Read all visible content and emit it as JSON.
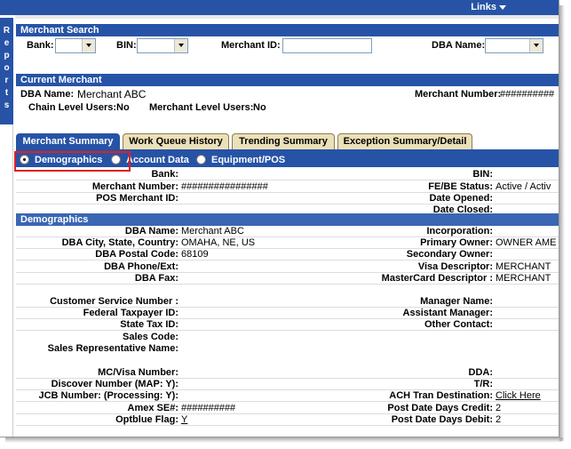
{
  "header": {
    "links_label": "Links"
  },
  "reports_tab": {
    "letters": [
      "R",
      "e",
      "p",
      "o",
      "r",
      "t",
      "s"
    ]
  },
  "merchant_search": {
    "title": "Merchant Search",
    "bank_label": "Bank:",
    "bin_label": "BIN:",
    "merchant_id_label": "Merchant ID:",
    "dba_name_label": "DBA Name:"
  },
  "current_merchant": {
    "title": "Current Merchant",
    "dba_name_label": "DBA Name:",
    "dba_name_value": "Merchant ABC",
    "merchant_number_label": "Merchant Number:",
    "merchant_number_value": "##########",
    "chain_users_label": "Chain Level Users:",
    "chain_users_value": "No",
    "merchant_users_label": "Merchant Level Users:",
    "merchant_users_value": "No"
  },
  "tabs": [
    {
      "label": "Merchant Summary"
    },
    {
      "label": "Work Queue History"
    },
    {
      "label": "Trending Summary"
    },
    {
      "label": "Exception Summary/Detail"
    }
  ],
  "radios": [
    {
      "label": "Demographics"
    },
    {
      "label": "Account Data"
    },
    {
      "label": "Equipment/POS"
    }
  ],
  "summary": {
    "bank_label": "Bank:",
    "bin_label": "BIN:",
    "merchant_number_label": "Merchant Number:",
    "merchant_number_value": "################",
    "febe_label": "FE/BE Status:",
    "febe_value": "Active / Activ",
    "pos_label": "POS Merchant ID:",
    "date_opened_label": "Date Opened:",
    "date_closed_label": "Date Closed:"
  },
  "demographics": {
    "title": "Demographics",
    "left": [
      {
        "label": "DBA Name:",
        "value": "Merchant ABC"
      },
      {
        "label": "DBA City, State, Country:",
        "value": "OMAHA, NE, US"
      },
      {
        "label": "DBA Postal Code:",
        "value": "68109"
      },
      {
        "label": "DBA Phone/Ext:",
        "value": ""
      },
      {
        "label": "DBA Fax:",
        "value": ""
      }
    ],
    "right": [
      {
        "label": "Incorporation:",
        "value": ""
      },
      {
        "label": "Primary Owner:",
        "value": "OWNER AME"
      },
      {
        "label": "Secondary Owner:",
        "value": ""
      },
      {
        "label": "Visa Descriptor:",
        "value": "MERCHANT"
      },
      {
        "label": "MasterCard Descriptor :",
        "value": "MERCHANT"
      }
    ],
    "left2": [
      {
        "label": "Customer Service Number :",
        "value": ""
      },
      {
        "label": "Federal Taxpayer ID:",
        "value": ""
      },
      {
        "label": "State Tax ID:",
        "value": ""
      },
      {
        "label": "Sales Code:",
        "value": ""
      },
      {
        "label": "Sales Representative Name:",
        "value": ""
      }
    ],
    "right2": [
      {
        "label": "Manager Name:",
        "value": ""
      },
      {
        "label": "Assistant Manager:",
        "value": ""
      },
      {
        "label": "Other Contact:",
        "value": ""
      }
    ],
    "left3": [
      {
        "label": "MC/Visa Number:",
        "value": ""
      },
      {
        "label": "Discover Number (MAP: Y):",
        "value": ""
      },
      {
        "label": "JCB Number: (Processing: Y):",
        "value": ""
      },
      {
        "label": "Amex SE#:",
        "value": "##########"
      },
      {
        "label": "Optblue Flag:",
        "value": "Y"
      }
    ],
    "right3": [
      {
        "label": "DDA:",
        "value": ""
      },
      {
        "label": "T/R:",
        "value": ""
      },
      {
        "label": "ACH Tran Destination:",
        "value": "Click Here"
      },
      {
        "label": "Post Date Days Credit:",
        "value": "2"
      },
      {
        "label": "Post Date Days Debit:",
        "value": "2"
      }
    ]
  }
}
